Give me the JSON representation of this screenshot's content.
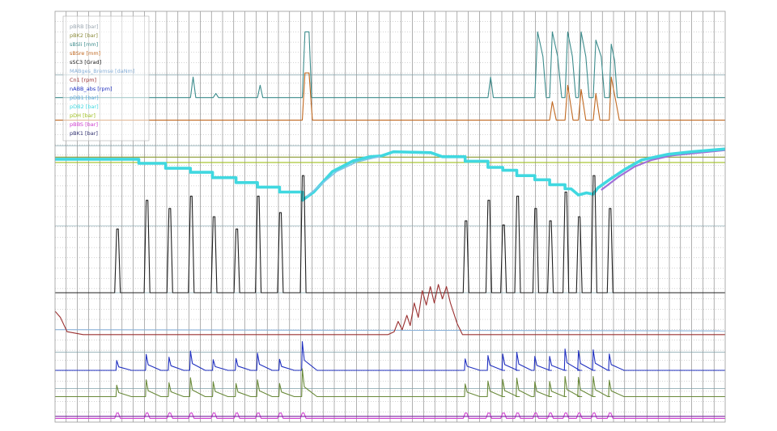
{
  "chart_data": {
    "type": "line",
    "title": "",
    "xlabel": "",
    "ylabel": "",
    "grid": true,
    "legend_position": "top-left",
    "xlim": [
      0,
      100
    ],
    "ylim": [
      0,
      100
    ],
    "legend": [
      {
        "label": "pBRB  [bar]",
        "color": "#9aa6b0"
      },
      {
        "label": "pBK2  [bar]",
        "color": "#8a8a3a"
      },
      {
        "label": "sBSli  [mm]",
        "color": "#3d8c8c"
      },
      {
        "label": "sBSre  [mm]",
        "color": "#c06820"
      },
      {
        "label": "sSC3  [Grad]",
        "color": "#202020"
      },
      {
        "label": "MABges_Bremse  [daNm]",
        "color": "#88b0d8"
      },
      {
        "label": "Cn1  [rpm]",
        "color": "#9a3030"
      },
      {
        "label": "nABB_abs  [rpm]",
        "color": "#2030c0"
      },
      {
        "label": "pDB1  [bar]",
        "color": "#60a8d8"
      },
      {
        "label": "pDB2  [bar]",
        "color": "#40d8e0"
      },
      {
        "label": "pDH  [bar]",
        "color": "#a0c020"
      },
      {
        "label": "pBBS  [bar]",
        "color": "#d040d0"
      },
      {
        "label": "pBK1  [bar]",
        "color": "#303070"
      }
    ],
    "events_a": [
      9.2,
      13.6,
      17.0,
      20.2,
      23.6,
      27.0,
      30.2,
      33.5,
      36.9
    ],
    "events_b": [
      61.2,
      64.6,
      66.8,
      68.9,
      71.6,
      73.8,
      76.1,
      78.1,
      80.3,
      82.7
    ],
    "series": [
      {
        "key": "teal",
        "color": "#3d8c8c",
        "values": [
          [
            0,
            79
          ],
          [
            20.2,
            79
          ],
          [
            20.6,
            84
          ],
          [
            21.0,
            79
          ],
          [
            23.6,
            79
          ],
          [
            24.0,
            80
          ],
          [
            24.4,
            79
          ],
          [
            30.2,
            79
          ],
          [
            30.6,
            82
          ],
          [
            31.0,
            79
          ],
          [
            36.9,
            79
          ],
          [
            37.3,
            95
          ],
          [
            37.9,
            95
          ],
          [
            38.3,
            79
          ],
          [
            64.6,
            79
          ],
          [
            65.0,
            84
          ],
          [
            65.4,
            79
          ],
          [
            71.6,
            79
          ],
          [
            72.0,
            95
          ],
          [
            72.8,
            89
          ],
          [
            73.3,
            79
          ],
          [
            73.8,
            79
          ],
          [
            74.2,
            95
          ],
          [
            75.0,
            89
          ],
          [
            75.6,
            79
          ],
          [
            76.1,
            79
          ],
          [
            76.5,
            95
          ],
          [
            77.2,
            89
          ],
          [
            77.7,
            79
          ],
          [
            78.1,
            79
          ],
          [
            78.5,
            95
          ],
          [
            79.2,
            89
          ],
          [
            79.7,
            79
          ],
          [
            80.3,
            79
          ],
          [
            80.7,
            93
          ],
          [
            81.5,
            89
          ],
          [
            82.0,
            79
          ],
          [
            82.7,
            79
          ],
          [
            83.0,
            92
          ],
          [
            83.5,
            88
          ],
          [
            83.9,
            79
          ],
          [
            100,
            79
          ]
        ]
      },
      {
        "key": "orange",
        "color": "#c06820",
        "values": [
          [
            0,
            73.5
          ],
          [
            36.9,
            73.5
          ],
          [
            37.3,
            85
          ],
          [
            37.9,
            85
          ],
          [
            38.4,
            73.5
          ],
          [
            73.8,
            73.5
          ],
          [
            74.2,
            78
          ],
          [
            74.8,
            73.5
          ],
          [
            76.1,
            73.5
          ],
          [
            76.5,
            82
          ],
          [
            77.3,
            73.5
          ],
          [
            78.1,
            73.5
          ],
          [
            78.5,
            81
          ],
          [
            79.2,
            73.5
          ],
          [
            80.3,
            73.5
          ],
          [
            80.7,
            80
          ],
          [
            81.3,
            73.5
          ],
          [
            82.7,
            73.5
          ],
          [
            83.0,
            84
          ],
          [
            83.7,
            78
          ],
          [
            84.2,
            73.5
          ],
          [
            100,
            73.5
          ]
        ]
      },
      {
        "key": "green",
        "color": "#8a9a30",
        "values": [
          [
            0,
            64.5
          ],
          [
            100,
            64.5
          ]
        ]
      },
      {
        "key": "yellow",
        "color": "#a0c020",
        "values": [
          [
            0,
            63.2
          ],
          [
            100,
            63.2
          ]
        ]
      },
      {
        "key": "cyan",
        "color": "#40d8e0",
        "values": [
          [
            0,
            64
          ],
          [
            12.5,
            64
          ],
          [
            12.5,
            63
          ],
          [
            16.5,
            63
          ],
          [
            16.5,
            61.8
          ],
          [
            20.2,
            61.8
          ],
          [
            20.2,
            60.8
          ],
          [
            23.5,
            60.8
          ],
          [
            23.5,
            59.5
          ],
          [
            27,
            59.5
          ],
          [
            27,
            58.3
          ],
          [
            30.2,
            58.3
          ],
          [
            30.2,
            57.2
          ],
          [
            33.5,
            57.2
          ],
          [
            33.5,
            56
          ],
          [
            36.9,
            56
          ],
          [
            36.9,
            54
          ],
          [
            38.6,
            56
          ],
          [
            41.4,
            61
          ],
          [
            44.5,
            63.6
          ],
          [
            47.0,
            64.6
          ],
          [
            48.7,
            64.8
          ],
          [
            50.5,
            65.8
          ],
          [
            56.1,
            65.6
          ],
          [
            57.8,
            64.6
          ],
          [
            61.2,
            64.6
          ],
          [
            61.2,
            63.5
          ],
          [
            64.6,
            63.5
          ],
          [
            64.6,
            62
          ],
          [
            66.8,
            62
          ],
          [
            66.8,
            61.3
          ],
          [
            68.9,
            61.3
          ],
          [
            68.9,
            60
          ],
          [
            71.6,
            60
          ],
          [
            71.6,
            59
          ],
          [
            73.8,
            59
          ],
          [
            73.8,
            57.8
          ],
          [
            76.1,
            57.8
          ],
          [
            76.1,
            56.8
          ],
          [
            77.0,
            56.8
          ],
          [
            78.1,
            55.3
          ],
          [
            79.3,
            55.8
          ],
          [
            80.3,
            55.5
          ],
          [
            81.0,
            57
          ],
          [
            82.7,
            59
          ],
          [
            85.0,
            61.5
          ],
          [
            87.5,
            63.8
          ],
          [
            91.5,
            65.2
          ],
          [
            95,
            65.8
          ],
          [
            100,
            66.5
          ]
        ]
      },
      {
        "key": "cyan2",
        "color": "#7cc6e8",
        "values": [
          [
            37.6,
            55
          ],
          [
            42,
            61
          ],
          [
            45,
            63.3
          ],
          [
            47.5,
            64.3
          ],
          [
            48.5,
            64.6
          ]
        ]
      },
      {
        "key": "violet",
        "color": "#a070d8",
        "values": [
          [
            81.5,
            56.5
          ],
          [
            84,
            59.6
          ],
          [
            86.5,
            62.2
          ],
          [
            89,
            63.8
          ],
          [
            92,
            64.9
          ],
          [
            100,
            66.2
          ]
        ]
      },
      {
        "key": "black",
        "color": "#202020",
        "values": []
      },
      {
        "key": "red",
        "color": "#9a3030",
        "values": [
          [
            0,
            27
          ],
          [
            0.8,
            25.5
          ],
          [
            1.8,
            22
          ],
          [
            4.2,
            21.3
          ],
          [
            49.7,
            21.3
          ],
          [
            50.6,
            22
          ],
          [
            51.2,
            24.5
          ],
          [
            51.8,
            22.5
          ],
          [
            52.5,
            26
          ],
          [
            53.0,
            23.5
          ],
          [
            53.6,
            29
          ],
          [
            54.2,
            25.5
          ],
          [
            54.8,
            32
          ],
          [
            55.4,
            28.5
          ],
          [
            56.0,
            33
          ],
          [
            56.6,
            29
          ],
          [
            57.2,
            33.5
          ],
          [
            57.8,
            30
          ],
          [
            58.4,
            33
          ],
          [
            59.0,
            29
          ],
          [
            60.0,
            24
          ],
          [
            60.8,
            21.3
          ],
          [
            100,
            21.3
          ]
        ]
      },
      {
        "key": "lightblue",
        "color": "#88b0d8",
        "values": [
          [
            0,
            22.5
          ],
          [
            100,
            22.2
          ]
        ]
      },
      {
        "key": "blue",
        "color": "#2030c0",
        "values": []
      },
      {
        "key": "olive",
        "color": "#6a8a3a",
        "values": []
      },
      {
        "key": "magenta",
        "color": "#d040d0",
        "values": []
      },
      {
        "key": "purple",
        "color": "#7a20a0",
        "values": [
          [
            0,
            1.4
          ],
          [
            100,
            1.4
          ]
        ]
      }
    ]
  }
}
